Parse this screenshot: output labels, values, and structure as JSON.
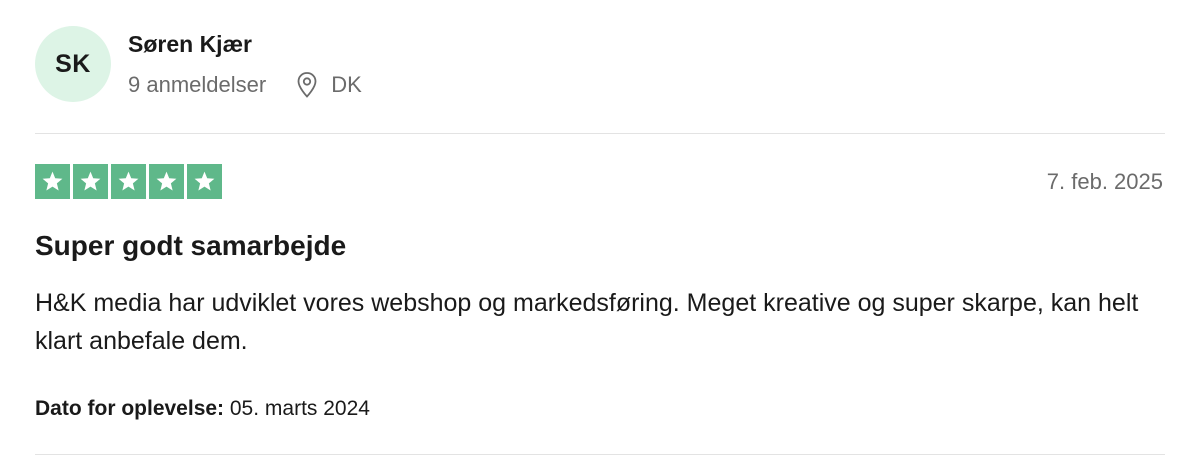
{
  "reviewer": {
    "initials": "SK",
    "name": "Søren Kjær",
    "review_count": "9 anmeldelser",
    "location": "DK",
    "location_icon": "location-pin-icon"
  },
  "review": {
    "rating": 5,
    "rating_max": 5,
    "star_color": "#5fb88a",
    "date": "7. feb. 2025",
    "title": "Super godt samarbejde",
    "body": "H&K media har udviklet vores webshop og markedsføring. Meget kreative og super skarpe, kan helt klart anbefale dem.",
    "experience_label": "Dato for oplevelse:",
    "experience_date": " 05. marts 2024"
  },
  "colors": {
    "avatar_bg": "#ddf4e6",
    "muted_text": "#6b6b6b",
    "divider": "#e3e3e3"
  }
}
